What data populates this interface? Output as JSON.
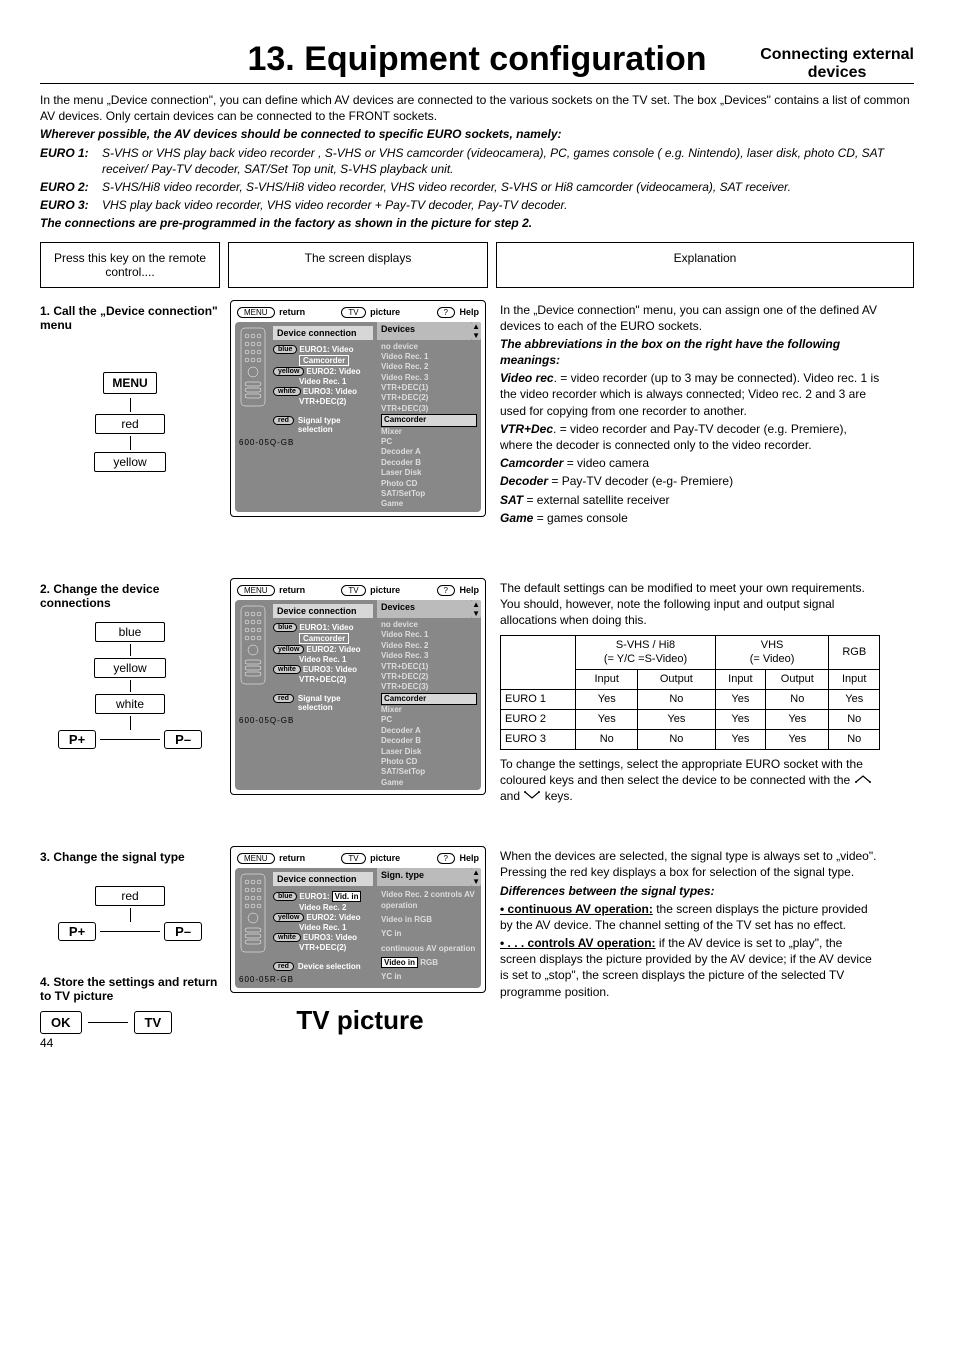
{
  "header": {
    "title": "13. Equipment configuration",
    "side1": "Connecting external",
    "side2": "devices"
  },
  "intro": {
    "p1": "In the menu „Device connection\", you can define which AV devices are connected to the various sockets on the TV set. The box „Devices\" contains a list of common AV devices. Only certain devices can be connected to the FRONT sockets.",
    "p2": "Wherever possible, the AV devices should be connected to specific EURO sockets, namely:",
    "euro1_lbl": "EURO 1:",
    "euro1_txt": "S-VHS or VHS play back video recorder , S-VHS or VHS camcorder (videocamera), PC, games console ( e.g. Nintendo), laser disk, photo CD, SAT receiver/ Pay-TV decoder, SAT/Set Top unit, S-VHS playback unit.",
    "euro2_lbl": "EURO 2:",
    "euro2_txt": "S-VHS/Hi8 video recorder, S-VHS/Hi8 video recorder, VHS video recorder, S-VHS or Hi8 camcorder (videocamera), SAT receiver.",
    "euro3_lbl": "EURO 3:",
    "euro3_txt": "VHS play back video recorder, VHS video recorder + Pay-TV decoder, Pay-TV decoder.",
    "p3": "The connections are pre-programmed in the factory as shown in the picture for step 2."
  },
  "columns_header": {
    "left": "Press this key on the remote control....",
    "mid": "The screen displays",
    "right": "Explanation"
  },
  "left": {
    "step1": "1. Call the „Device connection\" menu",
    "menu": "MENU",
    "red": "red",
    "yellow": "yellow",
    "step2": "2. Change the device connections",
    "blue": "blue",
    "white": "white",
    "pplus": "P+",
    "pminus": "P–",
    "step3": "3. Change the signal type",
    "step4": "4. Store the settings and return to TV picture",
    "ok": "OK",
    "tv": "TV"
  },
  "osd": {
    "return_tag": "MENU",
    "return": "return",
    "pic_tag": "TV",
    "picture": "picture",
    "help_tag": "?",
    "help": "Help",
    "head_left": "Device connection",
    "head_right": "Devices",
    "devices": [
      "no device",
      "Video Rec. 1",
      "Video Rec. 2",
      "Video Rec. 3",
      "VTR+DEC(1)",
      "VTR+DEC(2)",
      "VTR+DEC(3)",
      "Camcorder",
      "Mixer",
      "PC",
      "Decoder A",
      "Decoder B",
      "Laser Disk",
      "Photo CD",
      "SAT/SetTop",
      "Game"
    ],
    "e1_pill": "blue",
    "e1": "EURO1: Video",
    "e1_box": "Camcorder",
    "e2_pill": "yellow",
    "e2": "EURO2: Video",
    "e2_sub": "Video Rec. 1",
    "e3_pill": "white",
    "e3": "EURO3: Video",
    "e3_sub": "VTR+DEC(2)",
    "sig_pill": "red",
    "sig": "Signal type selection",
    "code": "600-05Q-GB",
    "devices_sel_idx_1": 7,
    "devices_sel_idx_2": 7
  },
  "osd3": {
    "head_right": "Sign. type",
    "list": [
      "Video Rec. 2 controls AV operation",
      "Video in RGB",
      "YC in",
      "continuous AV operation",
      "Video in RGB",
      "YC in"
    ],
    "sel_idx": 4,
    "sel_words": "Video in",
    "e1": "EURO1:",
    "e1_box": "Vid. in",
    "e1_sub": "Video Rec. 2",
    "e2": "EURO2: Video",
    "e2_sub": "Video Rec. 1",
    "e3": "EURO3: Video",
    "e3_sub": "VTR+DEC(2)",
    "foot_pill": "red",
    "foot": "Device selection",
    "code": "600-05R-GB"
  },
  "right1": {
    "p1": "In the „Device connection\" menu, you can assign one of the defined AV devices to each of the EURO sockets.",
    "p2": "The abbreviations in the box on the right have the following meanings:",
    "vr_lbl": "Video rec",
    "vr": ". = video recorder (up to 3 may be connected). Video rec. 1 is the video recorder which is always connected; Video rec. 2 and 3 are used for copying from one recorder to another.",
    "vd_lbl": "VTR+Dec",
    "vd": ". = video recorder and Pay-TV decoder (e.g. Premiere), where the decoder is connected only to the video recorder.",
    "cam_lbl": "Camcorder",
    "cam": " = video camera",
    "dec_lbl": "Decoder",
    "dec": " = Pay-TV decoder (e-g- Premiere)",
    "sat_lbl": "SAT",
    "sat": " = external satellite receiver",
    "game_lbl": "Game",
    "game": " = games console"
  },
  "right2": {
    "p1": "The default settings can be modified to meet your own requirements. You should, however, note the following input and output signal allocations when doing this.",
    "th1": "S-VHS / Hi8",
    "th1b": "(= Y/C =S-Video)",
    "th2": "VHS",
    "th2b": "(= Video)",
    "th3": "RGB",
    "sub_in": "Input",
    "sub_out": "Output",
    "rows": [
      {
        "lbl": "EURO 1",
        "v": [
          "Yes",
          "No",
          "Yes",
          "No",
          "Yes"
        ]
      },
      {
        "lbl": "EURO 2",
        "v": [
          "Yes",
          "Yes",
          "Yes",
          "Yes",
          "No"
        ]
      },
      {
        "lbl": "EURO 3",
        "v": [
          "No",
          "No",
          "Yes",
          "Yes",
          "No"
        ]
      }
    ],
    "p2a": "To change the settings, select the appropriate EURO socket with the coloured keys and then select the device to be connected with the ",
    "p2b": " and ",
    "p2c": " keys."
  },
  "right3": {
    "p1": "When the devices are selected, the signal type is always set to „video\". Pressing the red key displays a box for selection of the signal type.",
    "h": "Differences between the signal types:",
    "b1_lbl": "• continuous AV operation:",
    "b1": " the screen displays the picture provided by the AV device. The channel setting of the TV set has no effect.",
    "b2_lbl": "• . . . controls AV operation:",
    "b2": " if the AV device is set to „play\", the screen displays the picture provided by the AV device; if the AV device is set to „stop\", the screen displays the picture of the selected TV programme position."
  },
  "tv_picture": "TV picture",
  "page_number": "44"
}
